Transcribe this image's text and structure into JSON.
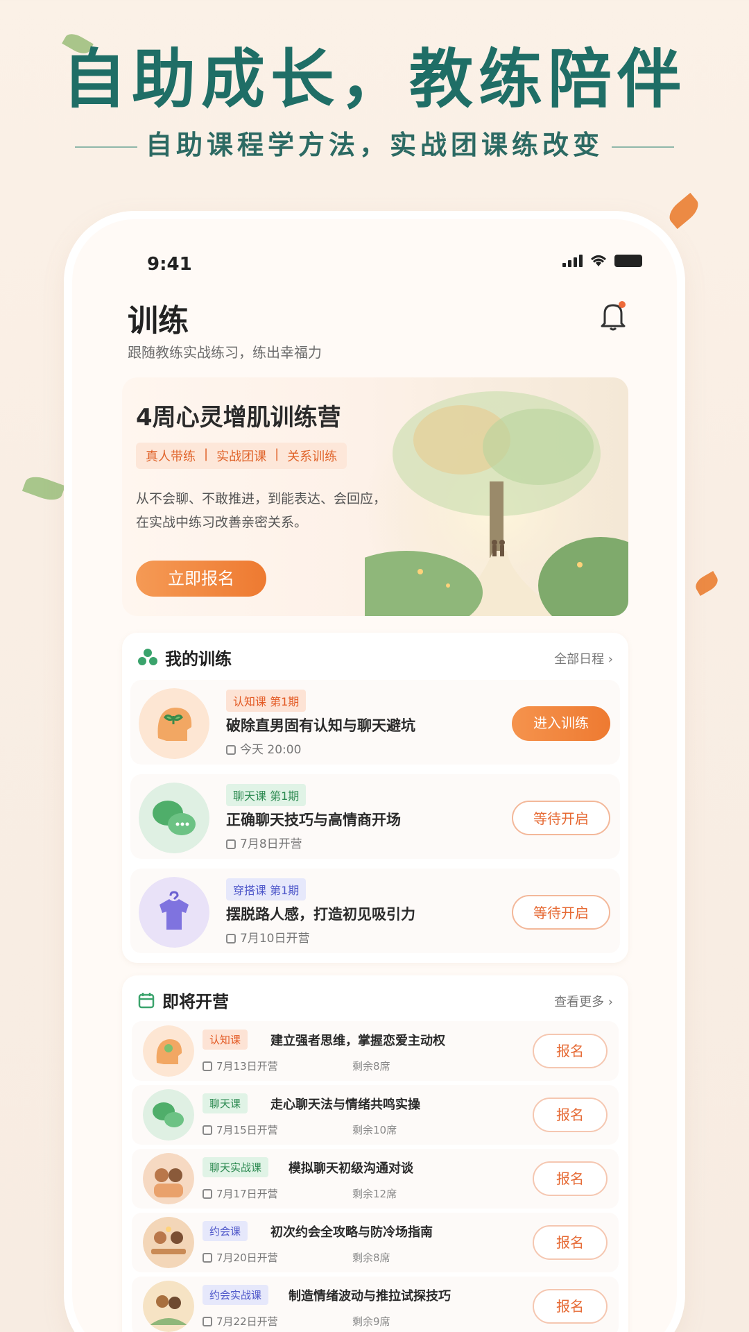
{
  "hero": {
    "title": "自助成长，教练陪伴",
    "subtitle": "自助课程学方法，实战团课练改变"
  },
  "status_bar": {
    "time": "9:41"
  },
  "page": {
    "title": "训练",
    "subtitle": "跟随教练实战练习，练出幸福力"
  },
  "banner": {
    "title": "4周心灵增肌训练营",
    "tags": [
      "真人带练",
      "|",
      "实战团课",
      "|",
      "关系训练"
    ],
    "desc_line1": "从不会聊、不敢推进，到能表达、会回应，",
    "desc_line2": "在实战中练习改善亲密关系。",
    "button": "立即报名"
  },
  "my_training": {
    "header": "我的训练",
    "more": "全部日程 ›",
    "items": [
      {
        "badge": "认知课 第1期",
        "badge_color": "orange",
        "title": "破除直男固有认知与聊天避坑",
        "time": "今天 20:00",
        "button": "进入训练",
        "button_style": "primary",
        "icon": "brain-sprout-icon"
      },
      {
        "badge": "聊天课 第1期",
        "badge_color": "green",
        "title": "正确聊天技巧与高情商开场",
        "time": "7月8日开营",
        "button": "等待开启",
        "button_style": "outline",
        "icon": "chat-bubbles-icon"
      },
      {
        "badge": "穿搭课 第1期",
        "badge_color": "blue",
        "title": "摆脱路人感，打造初见吸引力",
        "time": "7月10日开营",
        "button": "等待开启",
        "button_style": "outline",
        "icon": "shirt-hanger-icon"
      }
    ]
  },
  "upcoming": {
    "header": "即将开营",
    "more": "查看更多 ›",
    "items": [
      {
        "badge": "认知课",
        "badge_color": "orange",
        "title": "建立强者思维，掌握恋爱主动权",
        "date": "7月13日开营",
        "left": "剩余8席",
        "button": "报名"
      },
      {
        "badge": "聊天课",
        "badge_color": "green",
        "title": "走心聊天法与情绪共鸣实操",
        "date": "7月15日开营",
        "left": "剩余10席",
        "button": "报名"
      },
      {
        "badge": "聊天实战课",
        "badge_color": "green",
        "title": "模拟聊天初级沟通对谈",
        "date": "7月17日开营",
        "left": "剩余12席",
        "button": "报名"
      },
      {
        "badge": "约会课",
        "badge_color": "blue",
        "title": "初次约会全攻略与防冷场指南",
        "date": "7月20日开营",
        "left": "剩余8席",
        "button": "报名"
      },
      {
        "badge": "约会实战课",
        "badge_color": "blue",
        "title": "制造情绪波动与推拉试探技巧",
        "date": "7月22日开营",
        "left": "剩余9席",
        "button": "报名"
      }
    ]
  },
  "colors": {
    "accent": "#ee7a31",
    "brand_teal": "#1f6e66"
  }
}
